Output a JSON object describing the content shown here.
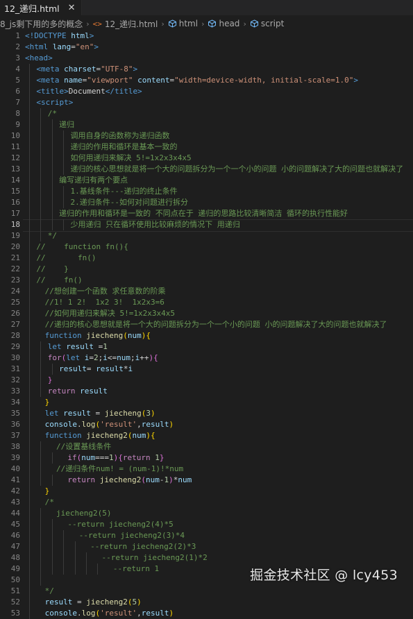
{
  "tab": {
    "title": "12_递归.html",
    "close_glyph": "✕"
  },
  "breadcrumb": {
    "items": [
      "8_js剩下用的多的概念",
      "12_递归.html",
      "html",
      "head",
      "script"
    ],
    "html_icon": "<>"
  },
  "editor": {
    "active_line": 18,
    "lines": [
      {
        "n": "1",
        "indent": 1,
        "tokens": [
          [
            "tag",
            "<!DOCTYPE "
          ],
          [
            "attr",
            "html"
          ],
          [
            "tag",
            ">"
          ]
        ]
      },
      {
        "n": "2",
        "indent": 1,
        "tokens": [
          [
            "tag",
            "<html "
          ],
          [
            "attr",
            "lang"
          ],
          [
            "txt",
            "="
          ],
          [
            "str",
            "\"en\""
          ],
          [
            "tag",
            ">"
          ]
        ]
      },
      {
        "n": "3",
        "indent": 1,
        "tokens": [
          [
            "tag",
            "<head>"
          ]
        ]
      },
      {
        "n": "4",
        "indent": 5,
        "tokens": [
          [
            "tag",
            "<meta "
          ],
          [
            "attr",
            "charset"
          ],
          [
            "txt",
            "="
          ],
          [
            "str",
            "\"UTF-8\""
          ],
          [
            "tag",
            ">"
          ]
        ]
      },
      {
        "n": "5",
        "indent": 5,
        "tokens": [
          [
            "tag",
            "<meta "
          ],
          [
            "attr",
            "name"
          ],
          [
            "txt",
            "="
          ],
          [
            "str",
            "\"viewport\""
          ],
          [
            "attr",
            " content"
          ],
          [
            "txt",
            "="
          ],
          [
            "str",
            "\"width=device-width, initial-scale=1.0\""
          ],
          [
            "tag",
            ">"
          ]
        ]
      },
      {
        "n": "6",
        "indent": 5,
        "tokens": [
          [
            "tag",
            "<title>"
          ],
          [
            "txt",
            "Document"
          ],
          [
            "tag",
            "</title>"
          ]
        ]
      },
      {
        "n": "7",
        "indent": 5,
        "tokens": [
          [
            "tag",
            "<script>"
          ]
        ]
      },
      {
        "n": "8",
        "indent": 9,
        "tokens": [
          [
            "com",
            "/*"
          ]
        ]
      },
      {
        "n": "9",
        "indent": 13,
        "tokens": [
          [
            "com",
            "递归"
          ]
        ]
      },
      {
        "n": "10",
        "indent": 17,
        "tokens": [
          [
            "com",
            "调用自身的函数称为递归函数"
          ]
        ]
      },
      {
        "n": "11",
        "indent": 17,
        "tokens": [
          [
            "com",
            "递归的作用和循环是基本一致的"
          ]
        ]
      },
      {
        "n": "12",
        "indent": 17,
        "tokens": [
          [
            "com",
            "如何用递归来解决 5!=1x2x3x4x5"
          ]
        ]
      },
      {
        "n": "13",
        "indent": 17,
        "tokens": [
          [
            "com",
            "递归的核心思想就是将一个大的问题拆分为一个一个小的问题 小的问题解决了大的问题也就解决了"
          ]
        ]
      },
      {
        "n": "14",
        "indent": 13,
        "tokens": [
          [
            "com",
            "编写递归有两个要点"
          ]
        ]
      },
      {
        "n": "15",
        "indent": 17,
        "tokens": [
          [
            "com",
            "1.基线条件---递归的终止条件"
          ]
        ]
      },
      {
        "n": "16",
        "indent": 17,
        "tokens": [
          [
            "com",
            "2.递归条件--如何对问题进行拆分"
          ]
        ]
      },
      {
        "n": "17",
        "indent": 13,
        "tokens": [
          [
            "com",
            "递归的作用和循环是一致的 不同点在于 递归的思路比较清晰简洁 循环的执行性能好"
          ]
        ]
      },
      {
        "n": "18",
        "indent": 17,
        "tokens": [
          [
            "com",
            "少用递归 只在循环使用比较麻烦的情况下 用递归"
          ]
        ]
      },
      {
        "n": "19",
        "indent": 9,
        "tokens": [
          [
            "com",
            "*/"
          ]
        ]
      },
      {
        "n": "20",
        "indent": 5,
        "tokens": [
          [
            "com",
            "//    function fn(){"
          ]
        ]
      },
      {
        "n": "21",
        "indent": 5,
        "tokens": [
          [
            "com",
            "//       fn()"
          ]
        ]
      },
      {
        "n": "22",
        "indent": 5,
        "tokens": [
          [
            "com",
            "//    }"
          ]
        ]
      },
      {
        "n": "23",
        "indent": 5,
        "tokens": [
          [
            "com",
            "//    fn()"
          ]
        ]
      },
      {
        "n": "24",
        "indent": 8,
        "tokens": [
          [
            "com",
            "//想创建一个函数 求任意数的阶乘"
          ]
        ]
      },
      {
        "n": "25",
        "indent": 8,
        "tokens": [
          [
            "com",
            "//1! 1 2!  1x2 3!  1x2x3=6"
          ]
        ]
      },
      {
        "n": "26",
        "indent": 8,
        "tokens": [
          [
            "com",
            "//如何用递归来解决 5!=1x2x3x4x5"
          ]
        ]
      },
      {
        "n": "27",
        "indent": 8,
        "tokens": [
          [
            "com",
            "//递归的核心思想就是将一个大的问题拆分为一个一个小的问题 小的问题解决了大的问题也就解决了"
          ]
        ]
      },
      {
        "n": "28",
        "indent": 8,
        "tokens": [
          [
            "kw",
            "function "
          ],
          [
            "fn",
            "jiecheng"
          ],
          [
            "br1",
            "("
          ],
          [
            "var",
            "num"
          ],
          [
            "br1",
            ")"
          ],
          [
            "br1",
            "{"
          ]
        ]
      },
      {
        "n": "29",
        "indent": 9,
        "tokens": [
          [
            "kw",
            "let "
          ],
          [
            "var",
            "result "
          ],
          [
            "txt",
            "="
          ],
          [
            "num",
            "1"
          ]
        ]
      },
      {
        "n": "30",
        "indent": 9,
        "tokens": [
          [
            "ctl",
            "for"
          ],
          [
            "br2",
            "("
          ],
          [
            "kw",
            "let "
          ],
          [
            "var",
            "i"
          ],
          [
            "txt",
            "="
          ],
          [
            "num",
            "2"
          ],
          [
            "txt",
            ";"
          ],
          [
            "var",
            "i"
          ],
          [
            "txt",
            "<="
          ],
          [
            "var",
            "num"
          ],
          [
            "txt",
            ";"
          ],
          [
            "var",
            "i"
          ],
          [
            "txt",
            "++"
          ],
          [
            "br2",
            ")"
          ],
          [
            "br2",
            "{"
          ]
        ]
      },
      {
        "n": "31",
        "indent": 13,
        "tokens": [
          [
            "var",
            "result"
          ],
          [
            "txt",
            "= "
          ],
          [
            "var",
            "result"
          ],
          [
            "txt",
            "*"
          ],
          [
            "var",
            "i"
          ]
        ]
      },
      {
        "n": "32",
        "indent": 9,
        "tokens": [
          [
            "br2",
            "}"
          ]
        ]
      },
      {
        "n": "33",
        "indent": 9,
        "tokens": [
          [
            "ctl",
            "return "
          ],
          [
            "var",
            "result"
          ]
        ]
      },
      {
        "n": "34",
        "indent": 8,
        "tokens": [
          [
            "br1",
            "}"
          ]
        ]
      },
      {
        "n": "35",
        "indent": 8,
        "tokens": [
          [
            "kw",
            "let "
          ],
          [
            "var",
            "result "
          ],
          [
            "txt",
            "= "
          ],
          [
            "fn",
            "jiecheng"
          ],
          [
            "br1",
            "("
          ],
          [
            "num",
            "3"
          ],
          [
            "br1",
            ")"
          ]
        ]
      },
      {
        "n": "36",
        "indent": 8,
        "tokens": [
          [
            "var",
            "console"
          ],
          [
            "txt",
            "."
          ],
          [
            "fn",
            "log"
          ],
          [
            "br1",
            "("
          ],
          [
            "str",
            "'result'"
          ],
          [
            "txt",
            ","
          ],
          [
            "var",
            "result"
          ],
          [
            "br1",
            ")"
          ]
        ]
      },
      {
        "n": "37",
        "indent": 8,
        "tokens": [
          [
            "kw",
            "function "
          ],
          [
            "fn",
            "jiecheng2"
          ],
          [
            "br1",
            "("
          ],
          [
            "var",
            "num"
          ],
          [
            "br1",
            ")"
          ],
          [
            "br1",
            "{"
          ]
        ]
      },
      {
        "n": "38",
        "indent": 12,
        "tokens": [
          [
            "com",
            "//设置基线条件"
          ]
        ]
      },
      {
        "n": "39",
        "indent": 16,
        "tokens": [
          [
            "ctl",
            "if"
          ],
          [
            "br2",
            "("
          ],
          [
            "var",
            "num"
          ],
          [
            "txt",
            "==="
          ],
          [
            "num",
            "1"
          ],
          [
            "br2",
            ")"
          ],
          [
            "br2",
            "{"
          ],
          [
            "ctl",
            "return "
          ],
          [
            "num",
            "1"
          ],
          [
            "br2",
            "}"
          ]
        ]
      },
      {
        "n": "40",
        "indent": 12,
        "tokens": [
          [
            "com",
            "//递归条件num! = (num-1)!*num"
          ]
        ]
      },
      {
        "n": "41",
        "indent": 16,
        "tokens": [
          [
            "ctl",
            "return "
          ],
          [
            "fn",
            "jiecheng2"
          ],
          [
            "br2",
            "("
          ],
          [
            "var",
            "num"
          ],
          [
            "txt",
            "-"
          ],
          [
            "num",
            "1"
          ],
          [
            "br2",
            ")"
          ],
          [
            "txt",
            "*"
          ],
          [
            "var",
            "num"
          ]
        ]
      },
      {
        "n": "42",
        "indent": 8,
        "tokens": [
          [
            "br1",
            "}"
          ]
        ]
      },
      {
        "n": "43",
        "indent": 8,
        "tokens": [
          [
            "com",
            "/*"
          ]
        ]
      },
      {
        "n": "44",
        "indent": 12,
        "tokens": [
          [
            "com",
            "jiecheng2(5)"
          ]
        ]
      },
      {
        "n": "45",
        "indent": 16,
        "tokens": [
          [
            "com",
            "--return jiecheng2(4)*5"
          ]
        ]
      },
      {
        "n": "46",
        "indent": 20,
        "tokens": [
          [
            "com",
            "--return jiecheng2(3)*4"
          ]
        ]
      },
      {
        "n": "47",
        "indent": 24,
        "tokens": [
          [
            "com",
            "--return jiecheng2(2)*3"
          ]
        ]
      },
      {
        "n": "48",
        "indent": 28,
        "tokens": [
          [
            "com",
            "--return jiecheng2(1)*2"
          ]
        ]
      },
      {
        "n": "49",
        "indent": 32,
        "tokens": [
          [
            "com",
            "--return 1"
          ]
        ]
      },
      {
        "n": "50",
        "indent": 12,
        "tokens": []
      },
      {
        "n": "51",
        "indent": 8,
        "tokens": [
          [
            "com",
            "*/"
          ]
        ]
      },
      {
        "n": "52",
        "indent": 8,
        "tokens": [
          [
            "var",
            "result "
          ],
          [
            "txt",
            "= "
          ],
          [
            "fn",
            "jiecheng2"
          ],
          [
            "br1",
            "("
          ],
          [
            "num",
            "5"
          ],
          [
            "br1",
            ")"
          ]
        ]
      },
      {
        "n": "53",
        "indent": 8,
        "tokens": [
          [
            "var",
            "console"
          ],
          [
            "txt",
            "."
          ],
          [
            "fn",
            "log"
          ],
          [
            "br1",
            "("
          ],
          [
            "str",
            "'result'"
          ],
          [
            "txt",
            ","
          ],
          [
            "var",
            "result"
          ],
          [
            "br1",
            ")"
          ]
        ]
      }
    ]
  },
  "watermark": "掘金技术社区 @ lcy453"
}
